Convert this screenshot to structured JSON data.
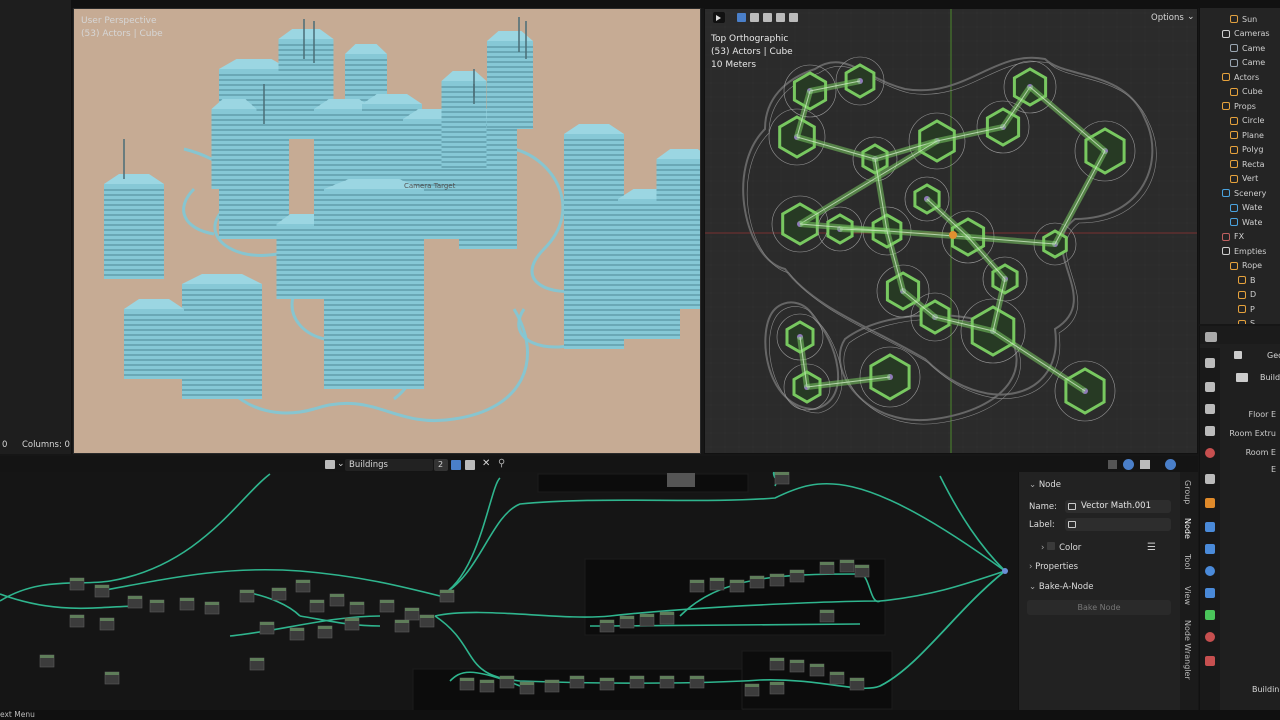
{
  "left_strip": {
    "row_count_label": "0",
    "columns_label": "Columns: 0"
  },
  "perspective_viewport": {
    "view_name": "User Perspective",
    "collection_info": "(53) Actors | Cube",
    "target_label": "Camera Target",
    "ground_color": "#c6ab94",
    "building_color": "#86c8d6"
  },
  "ortho_viewport": {
    "view_name": "Top Orthographic",
    "collection_info": "(53) Actors | Cube",
    "scale_label": "10 Meters",
    "options_label": "Options",
    "wire_color": "#78c860"
  },
  "outliner": {
    "items": [
      {
        "label": "Sun",
        "icon": "light-icon",
        "color": "#e0a040"
      },
      {
        "label": "Cameras",
        "icon": "collection-icon",
        "color": "#d0d0d0"
      },
      {
        "label": "Came",
        "icon": "camera-icon",
        "color": "#9aa6b2"
      },
      {
        "label": "Came",
        "icon": "camera-icon",
        "color": "#9aa6b2"
      },
      {
        "label": "Actors",
        "icon": "collection-icon",
        "color": "#e6a23c"
      },
      {
        "label": "Cube",
        "icon": "mesh-icon",
        "color": "#e6a23c"
      },
      {
        "label": "Props",
        "icon": "collection-icon",
        "color": "#e6a23c"
      },
      {
        "label": "Circle",
        "icon": "curve-icon",
        "color": "#e6a23c"
      },
      {
        "label": "Plane",
        "icon": "curve-icon",
        "color": "#e6a23c"
      },
      {
        "label": "Polyg",
        "icon": "curve-icon",
        "color": "#e6a23c"
      },
      {
        "label": "Recta",
        "icon": "curve-icon",
        "color": "#e6a23c"
      },
      {
        "label": "Vert",
        "icon": "mesh-icon",
        "color": "#e6a23c"
      },
      {
        "label": "Scenery",
        "icon": "collection-icon",
        "color": "#4aa3df"
      },
      {
        "label": "Wate",
        "icon": "mesh-icon",
        "color": "#4aa3df"
      },
      {
        "label": "Wate",
        "icon": "mesh-icon",
        "color": "#4aa3df"
      },
      {
        "label": "FX",
        "icon": "collection-icon",
        "color": "#c06060"
      },
      {
        "label": "Empties",
        "icon": "collection-icon",
        "color": "#d0d0d0"
      },
      {
        "label": "Rope",
        "icon": "empty-icon",
        "color": "#e6a23c"
      },
      {
        "label": "B",
        "icon": "empty-icon",
        "color": "#e6a23c"
      },
      {
        "label": "D",
        "icon": "empty-icon",
        "color": "#e6a23c"
      },
      {
        "label": "P",
        "icon": "empty-icon",
        "color": "#e6a23c"
      },
      {
        "label": "S",
        "icon": "empty-icon",
        "color": "#e6a23c"
      }
    ]
  },
  "properties_panel": {
    "header_label": "Geo",
    "modifier_label": "Build",
    "fields": [
      {
        "label": "Floor E"
      },
      {
        "label": "Room Extru"
      },
      {
        "label": "Room E"
      },
      {
        "label": "E"
      }
    ],
    "footer_label": "Buildin"
  },
  "node_editor": {
    "tree_name": "Buildings",
    "user_count": "2",
    "link_color": "#2fb58e"
  },
  "n_panel": {
    "section_node": "Node",
    "name_label": "Name:",
    "name_value": "Vector Math.001",
    "label_label": "Label:",
    "label_value": "",
    "color_section": "Color",
    "properties_section": "Properties",
    "bake_section": "Bake-A-Node",
    "bake_button": "Bake Node"
  },
  "side_tabs": [
    "Group",
    "Node",
    "Tool",
    "View",
    "Node Wrangler"
  ],
  "status_bar": {
    "context_menu": "ext Menu"
  }
}
